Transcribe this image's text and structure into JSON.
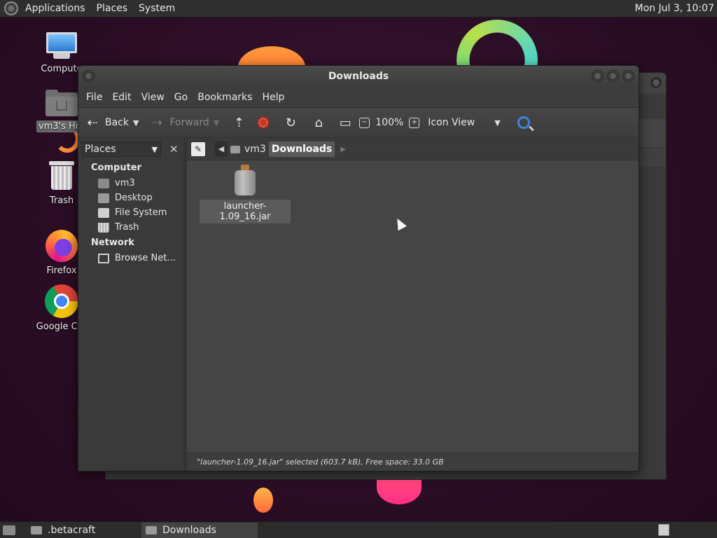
{
  "top_panel": {
    "menus": [
      "Applications",
      "Places",
      "System"
    ],
    "clock": "Mon Jul  3, 10:07"
  },
  "desktop": {
    "icons": [
      {
        "label": "Compute",
        "icon": "computer-icon"
      },
      {
        "label": "vm3's Hor",
        "icon": "home-folder-icon"
      },
      {
        "label": "Trash",
        "icon": "trash-icon"
      },
      {
        "label": "Firefox",
        "icon": "firefox-icon"
      },
      {
        "label": "Google Chr",
        "icon": "chrome-icon"
      }
    ]
  },
  "window": {
    "title": "Downloads",
    "menu": [
      "File",
      "Edit",
      "View",
      "Go",
      "Bookmarks",
      "Help"
    ],
    "toolbar": {
      "back": "Back",
      "forward": "Forward",
      "zoom": "100%",
      "view_mode": "Icon View"
    },
    "sidebar": {
      "combo": "Places",
      "sections": [
        {
          "title": "Computer",
          "items": [
            "vm3",
            "Desktop",
            "File System",
            "Trash"
          ]
        },
        {
          "title": "Network",
          "items": [
            "Browse Net…"
          ]
        }
      ]
    },
    "pathbar": [
      "vm3",
      "Downloads"
    ],
    "files": [
      {
        "name": "launcher-1.09_16.jar",
        "selected": true
      }
    ],
    "status": "\"launcher-1.09_16.jar\" selected (603.7 kB), Free space: 33.0 GB"
  },
  "taskbar": {
    "windows": [
      {
        "label": ".betacraft",
        "active": false
      },
      {
        "label": "Downloads",
        "active": true
      }
    ]
  },
  "colors": {
    "desktop_bg": "#2a0d24",
    "window_bg": "#3d3d3d",
    "stop_red": "#c0392b",
    "search_blue": "#3e86d6"
  }
}
